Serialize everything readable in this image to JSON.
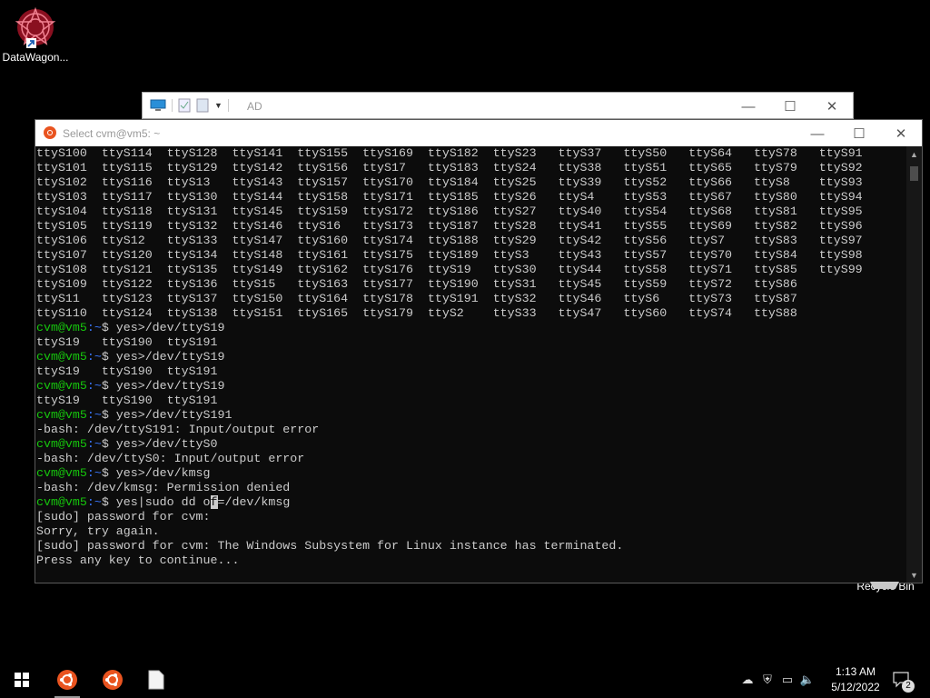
{
  "desktop": {
    "icons": [
      {
        "label": "DataWagon..."
      },
      {
        "label": "Recycle Bin"
      }
    ]
  },
  "background_window": {
    "title": "AD"
  },
  "terminal": {
    "title": "Select cvm@vm5: ~",
    "lines": [
      {
        "t": "out",
        "text": "ttyS100  ttyS114  ttyS128  ttyS141  ttyS155  ttyS169  ttyS182  ttyS23   ttyS37   ttyS50   ttyS64   ttyS78   ttyS91"
      },
      {
        "t": "out",
        "text": "ttyS101  ttyS115  ttyS129  ttyS142  ttyS156  ttyS17   ttyS183  ttyS24   ttyS38   ttyS51   ttyS65   ttyS79   ttyS92"
      },
      {
        "t": "out",
        "text": "ttyS102  ttyS116  ttyS13   ttyS143  ttyS157  ttyS170  ttyS184  ttyS25   ttyS39   ttyS52   ttyS66   ttyS8    ttyS93"
      },
      {
        "t": "out",
        "text": "ttyS103  ttyS117  ttyS130  ttyS144  ttyS158  ttyS171  ttyS185  ttyS26   ttyS4    ttyS53   ttyS67   ttyS80   ttyS94"
      },
      {
        "t": "out",
        "text": "ttyS104  ttyS118  ttyS131  ttyS145  ttyS159  ttyS172  ttyS186  ttyS27   ttyS40   ttyS54   ttyS68   ttyS81   ttyS95"
      },
      {
        "t": "out",
        "text": "ttyS105  ttyS119  ttyS132  ttyS146  ttyS16   ttyS173  ttyS187  ttyS28   ttyS41   ttyS55   ttyS69   ttyS82   ttyS96"
      },
      {
        "t": "out",
        "text": "ttyS106  ttyS12   ttyS133  ttyS147  ttyS160  ttyS174  ttyS188  ttyS29   ttyS42   ttyS56   ttyS7    ttyS83   ttyS97"
      },
      {
        "t": "out",
        "text": "ttyS107  ttyS120  ttyS134  ttyS148  ttyS161  ttyS175  ttyS189  ttyS3    ttyS43   ttyS57   ttyS70   ttyS84   ttyS98"
      },
      {
        "t": "out",
        "text": "ttyS108  ttyS121  ttyS135  ttyS149  ttyS162  ttyS176  ttyS19   ttyS30   ttyS44   ttyS58   ttyS71   ttyS85   ttyS99"
      },
      {
        "t": "out",
        "text": "ttyS109  ttyS122  ttyS136  ttyS15   ttyS163  ttyS177  ttyS190  ttyS31   ttyS45   ttyS59   ttyS72   ttyS86"
      },
      {
        "t": "out",
        "text": "ttyS11   ttyS123  ttyS137  ttyS150  ttyS164  ttyS178  ttyS191  ttyS32   ttyS46   ttyS6    ttyS73   ttyS87"
      },
      {
        "t": "out",
        "text": "ttyS110  ttyS124  ttyS138  ttyS151  ttyS165  ttyS179  ttyS2    ttyS33   ttyS47   ttyS60   ttyS74   ttyS88"
      },
      {
        "t": "cmd",
        "user": "cvm@vm5",
        "path": ":~",
        "cmd": "$ yes>/dev/ttyS19"
      },
      {
        "t": "out",
        "text": "ttyS19   ttyS190  ttyS191"
      },
      {
        "t": "cmd",
        "user": "cvm@vm5",
        "path": ":~",
        "cmd": "$ yes>/dev/ttyS19"
      },
      {
        "t": "out",
        "text": "ttyS19   ttyS190  ttyS191"
      },
      {
        "t": "cmd",
        "user": "cvm@vm5",
        "path": ":~",
        "cmd": "$ yes>/dev/ttyS19"
      },
      {
        "t": "out",
        "text": "ttyS19   ttyS190  ttyS191"
      },
      {
        "t": "cmd",
        "user": "cvm@vm5",
        "path": ":~",
        "cmd": "$ yes>/dev/ttyS191"
      },
      {
        "t": "out",
        "text": "-bash: /dev/ttyS191: Input/output error"
      },
      {
        "t": "cmd",
        "user": "cvm@vm5",
        "path": ":~",
        "cmd": "$ yes>/dev/ttyS0"
      },
      {
        "t": "out",
        "text": "-bash: /dev/ttyS0: Input/output error"
      },
      {
        "t": "cmd",
        "user": "cvm@vm5",
        "path": ":~",
        "cmd": "$ yes>/dev/kmsg"
      },
      {
        "t": "out",
        "text": "-bash: /dev/kmsg: Permission denied"
      },
      {
        "t": "cmd",
        "user": "cvm@vm5",
        "path": ":~",
        "cmd": "$ yes|sudo dd o",
        "cursor": "f",
        "after": "=/dev/kmsg"
      },
      {
        "t": "out",
        "text": "[sudo] password for cvm:"
      },
      {
        "t": "out",
        "text": "Sorry, try again."
      },
      {
        "t": "out",
        "text": "[sudo] password for cvm: The Windows Subsystem for Linux instance has terminated."
      },
      {
        "t": "out",
        "text": "Press any key to continue..."
      }
    ]
  },
  "taskbar": {
    "clock_time": "1:13 AM",
    "clock_date": "5/12/2022",
    "notification_count": "2"
  },
  "colors": {
    "prompt_user": "#16c60c",
    "prompt_path": "#3b78ff",
    "terminal_bg": "#0c0c0c",
    "terminal_fg": "#cccccc",
    "ubuntu": "#e95420"
  }
}
